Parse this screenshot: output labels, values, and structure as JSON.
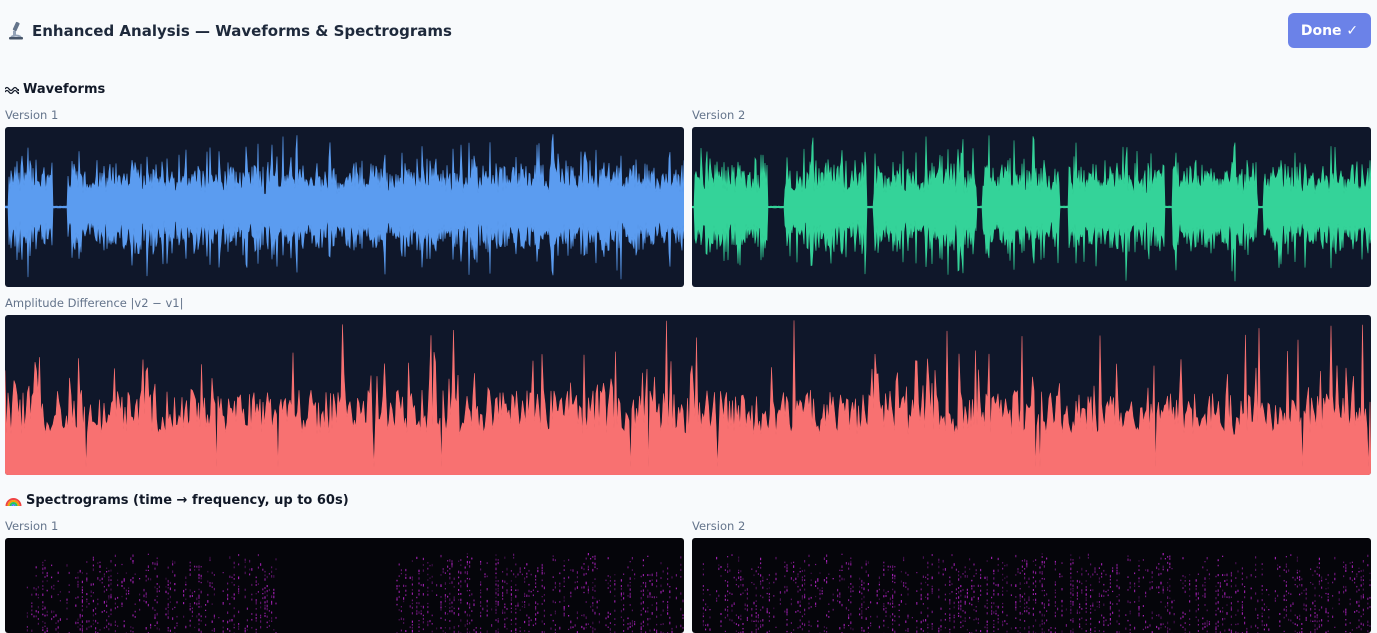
{
  "header": {
    "icon": "microscope-icon",
    "title": "Enhanced Analysis — Waveforms & Spectrograms",
    "done_label": "Done ✓"
  },
  "waveforms": {
    "icon": "wave-icon",
    "title": "Waveforms",
    "version1_label": "Version 1",
    "version2_label": "Version 2",
    "difference_label": "Amplitude Difference |v2 − v1|"
  },
  "spectrograms": {
    "icon": "rainbow-icon",
    "title": "Spectrograms (time → frequency, up to 60s)",
    "version1_label": "Version 1",
    "version2_label": "Version 2"
  },
  "colors": {
    "panel_bg": "#0f172a",
    "version1_wave": "#5b9cf0",
    "version2_wave": "#34d399",
    "difference": "#f87171",
    "spectrogram": "#c026d3",
    "done_button": "#6b82e8"
  }
}
